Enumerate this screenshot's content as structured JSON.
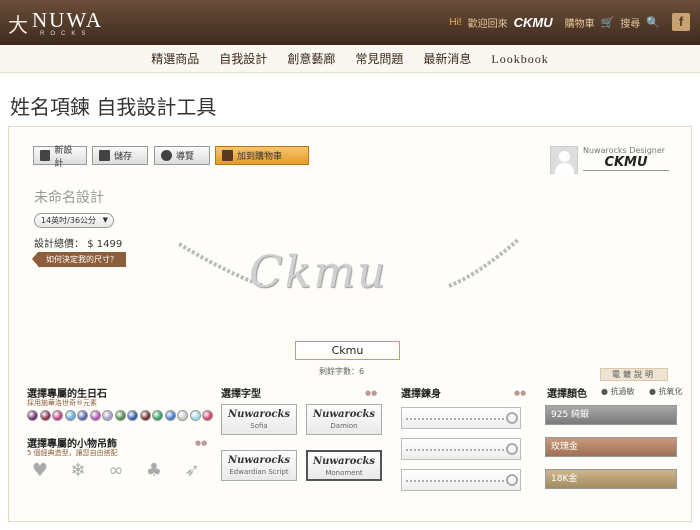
{
  "header": {
    "logo_mark": "⼤",
    "logo_word": "NUWA",
    "logo_sub": "ROCKS",
    "hi": "Hi!",
    "welcome": "歡迎回來",
    "user": "CKMU",
    "cart": "購物車",
    "search": "搜尋",
    "fb": "f"
  },
  "nav": [
    "精選商品",
    "自我設計",
    "創意藝廊",
    "常見問題",
    "最新消息",
    "Lookbook"
  ],
  "page_title": "姓名項鍊 自我設計工具",
  "toolbar": {
    "new": "新設計",
    "save": "儲存",
    "guide": "導覽",
    "cart": "加到購物車"
  },
  "designer": {
    "label": "Nuwarocks Designer",
    "name": "CKMU"
  },
  "design": {
    "name_placeholder": "未命名設計",
    "size": "14英吋/36公分",
    "total_label": "設計總價：",
    "total_value": "$ 1499",
    "size_help": "如何決定我的尺寸？"
  },
  "preview": {
    "necklace_text": "Ckmu"
  },
  "name_input": {
    "value": "Ckmu",
    "remain": "剩餘字數：6"
  },
  "color_guide": "電鍍說明",
  "birthstone": {
    "title": "選擇專屬的生日石",
    "sub": "採用施華洛世奇®元素",
    "colors": [
      "#6b2c6b",
      "#8a2b4b",
      "#c04080",
      "#5fa8d8",
      "#5060b8",
      "#b050b0",
      "#a8a0c0",
      "#4a8a4a",
      "#2a5ab0",
      "#6f2b2b",
      "#2aa060",
      "#3a7ad0",
      "#c8c8c8",
      "#9fd8f0",
      "#d04060"
    ]
  },
  "charm": {
    "title": "選擇專屬的小物吊飾",
    "sub": "5 個經典造型，讓您自由搭配",
    "icons": [
      "heart",
      "snowflake",
      "bone",
      "clover",
      "wing"
    ]
  },
  "font": {
    "title": "選擇字型",
    "tiles": [
      {
        "sample": "Nuwarocks",
        "name": "Sofia"
      },
      {
        "sample": "Nuwarocks",
        "name": "Damion"
      },
      {
        "sample": "Nuwarocks",
        "name": "Edwardian Script"
      },
      {
        "sample": "Nuwarocks",
        "name": "Monoment"
      }
    ]
  },
  "chain": {
    "title": "選擇鍊身"
  },
  "metal": {
    "title": "選擇顏色",
    "opt1": "抗過敏",
    "opt2": "抗氧化",
    "items": [
      {
        "label": "925 純銀",
        "color": "#8d8d8d"
      },
      {
        "label": "玫瑰金",
        "color": "#b4866a"
      },
      {
        "label": "18K金",
        "color": "#b9a176"
      }
    ]
  }
}
